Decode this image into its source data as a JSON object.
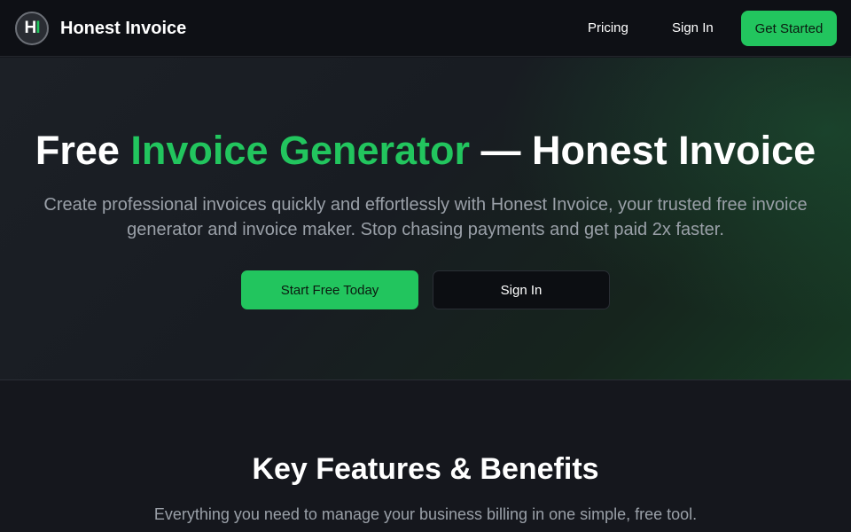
{
  "nav": {
    "logo_h": "H",
    "logo_i": "I",
    "brand": "Honest Invoice",
    "links": {
      "pricing": "Pricing",
      "signin": "Sign In"
    },
    "cta": "Get Started"
  },
  "hero": {
    "title_part1": "Free ",
    "title_accent": "Invoice Generator",
    "title_part2": " — Honest Invoice",
    "subtitle": "Create professional invoices quickly and effortlessly with Honest Invoice, your trusted free invoice generator and invoice maker. Stop chasing payments and get paid 2x faster.",
    "primary_button": "Start Free Today",
    "secondary_button": "Sign In"
  },
  "features": {
    "title": "Key Features & Benefits",
    "subtitle": "Everything you need to manage your business billing in one simple, free tool."
  },
  "colors": {
    "accent": "#22c55e",
    "nav_bg": "#0e1015",
    "page_bg": "#15171d",
    "muted_text": "#9aa0a8"
  }
}
